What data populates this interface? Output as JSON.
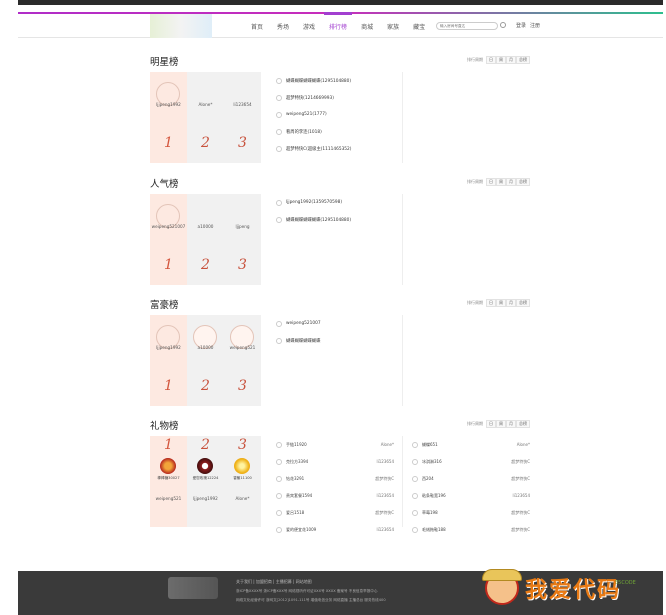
{
  "nav": {
    "items": [
      "首页",
      "秀场",
      "游戏",
      "排行榜",
      "商城",
      "家族",
      "藏宝"
    ],
    "active_index": 3,
    "search_placeholder": "输入房间号直达",
    "login": "登录",
    "register": "注册"
  },
  "period": {
    "label": "排行周期",
    "options": [
      "日",
      "周",
      "月",
      "总榜"
    ]
  },
  "sections": {
    "star": {
      "title": "明星榜",
      "cards": [
        {
          "name": "ljjpeng1992",
          "rank": "1"
        },
        {
          "name": "Alone*",
          "rank": "2"
        },
        {
          "name": "li123654",
          "rank": "3"
        }
      ],
      "list": [
        "蝴蝶蝴蝶蝴蝶蝴蝶(1295104880)",
        "超梦特快(1214669993)",
        "weipeng521(1777)",
        "看周的李连(1018)",
        "超梦特快C(超级主(1111465352)"
      ]
    },
    "popular": {
      "title": "人气榜",
      "cards": [
        {
          "name": "weipeng521007",
          "rank": "1"
        },
        {
          "name": "a10000",
          "rank": "2"
        },
        {
          "name": "ljjpeng",
          "rank": "3"
        }
      ],
      "list": [
        "ljjpeng1992(1359570598)",
        "蝴蝶蝴蝶蝴蝶蝴蝶(1295104880)"
      ]
    },
    "rich": {
      "title": "富豪榜",
      "cards": [
        {
          "name": "ljjpeng1992",
          "rank": "1"
        },
        {
          "name": "a10000",
          "rank": "2"
        },
        {
          "name": "weipeng521",
          "rank": "3"
        }
      ],
      "list": [
        "weipeng521007",
        "蝴蝶蝴蝶蝴蝶蝴蝶"
      ]
    },
    "gift": {
      "title": "礼物榜",
      "cards": [
        {
          "rank": "1",
          "gift": "棒棒糖30027",
          "name": "weipeng521"
        },
        {
          "rank": "2",
          "gift": "爱您玫瑰12224",
          "name": "ljjpeng1992"
        },
        {
          "rank": "3",
          "gift": "香蕉11100",
          "name": "Alone*"
        }
      ],
      "left_list": [
        {
          "gift": "手链11920",
          "user": "Alone*"
        },
        {
          "gift": "克拉方3394",
          "user": "li123654"
        },
        {
          "gift": "钻花3291",
          "user": "超梦特快C"
        },
        {
          "gift": "贵宾套餐1594",
          "user": "li123654"
        },
        {
          "gift": "爱吕1518",
          "user": "超梦特快C"
        },
        {
          "gift": "爱的便宜花1009",
          "user": "li123654"
        }
      ],
      "right_list": [
        {
          "gift": "蝴蝶651",
          "user": "Alone*"
        },
        {
          "gift": "冰淇淋316",
          "user": "超梦特快C"
        },
        {
          "gift": "西204",
          "user": "超梦特快C"
        },
        {
          "gift": "粘条鞋宽196",
          "user": "li123654"
        },
        {
          "gift": "草莓198",
          "user": "超梦特快C"
        },
        {
          "gift": "毛绒拖鞋188",
          "user": "超梦特快C"
        }
      ]
    }
  },
  "footer": {
    "links": "关于我们 | 加盟招商 | 主播招募 | 网站地图",
    "line1": "浙ICP备XXXX号 浙ICP备XXX号 网络视听许可证XXX号 XXXX 备案号 不良信息举报中心",
    "line2": "网络文化经营许可 浙网文[2012]1091-111号 增值电信业务 网络直播 主播总台 服务热线400"
  },
  "watermark": {
    "text": "我爱代码",
    "sub": "55CODE"
  },
  "colors": {
    "accent": "#a23fd0",
    "rank": "#c8523d",
    "first_card": "#fde9e1"
  }
}
